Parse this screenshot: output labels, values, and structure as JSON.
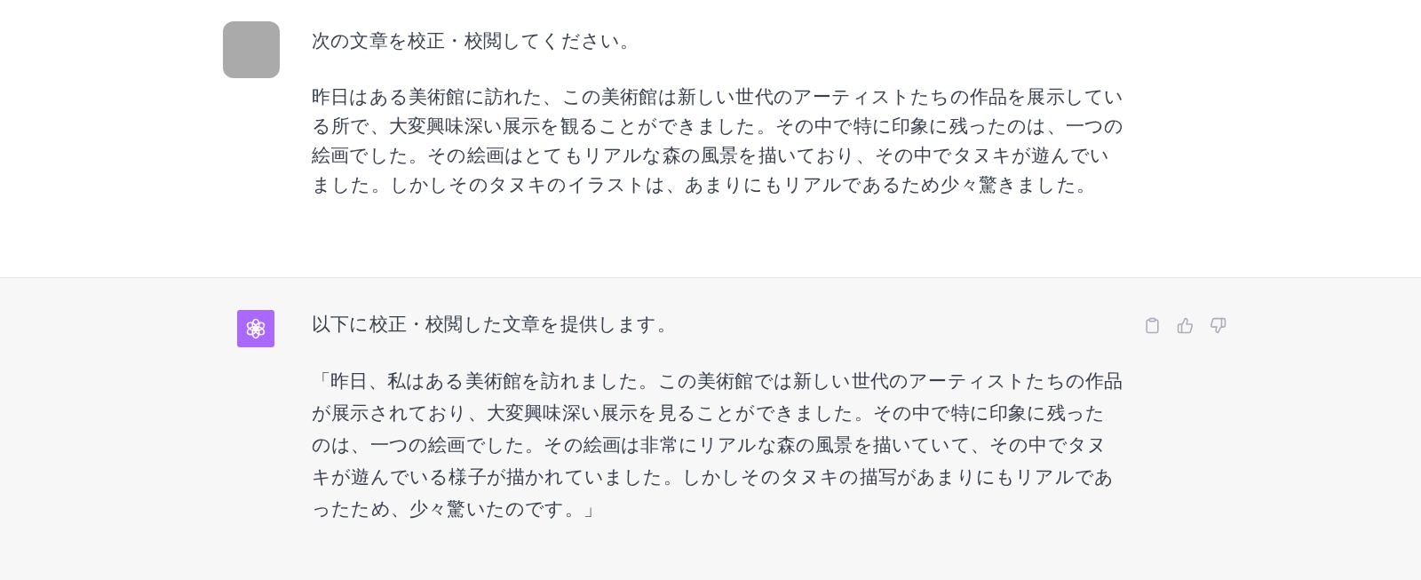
{
  "messages": [
    {
      "kind": "user",
      "paragraphs": [
        "次の文章を校正・校閲してください。",
        "昨日はある美術館に訪れた、この美術館は新しい世代のアーティストたちの作品を展示している所で、大変興味深い展示を観ることができました。その中で特に印象に残ったのは、一つの絵画でした。その絵画はとてもリアルな森の風景を描いており、その中でタヌキが遊んでいました。しかしそのタヌキのイラストは、あまりにもリアルであるため少々驚きました。"
      ]
    },
    {
      "kind": "assistant",
      "paragraphs": [
        "以下に校正・校閲した文章を提供します。",
        "「昨日、私はある美術館を訪れました。この美術館では新しい世代のアーティストたちの作品が展示されており、大変興味深い展示を見ることができました。その中で特に印象に残ったのは、一つの絵画でした。その絵画は非常にリアルな森の風景を描いていて、その中でタヌキが遊んでいる様子が描かれていました。しかしそのタヌキの描写があまりにもリアルであったため、少々驚いたのです。」"
      ]
    }
  ]
}
